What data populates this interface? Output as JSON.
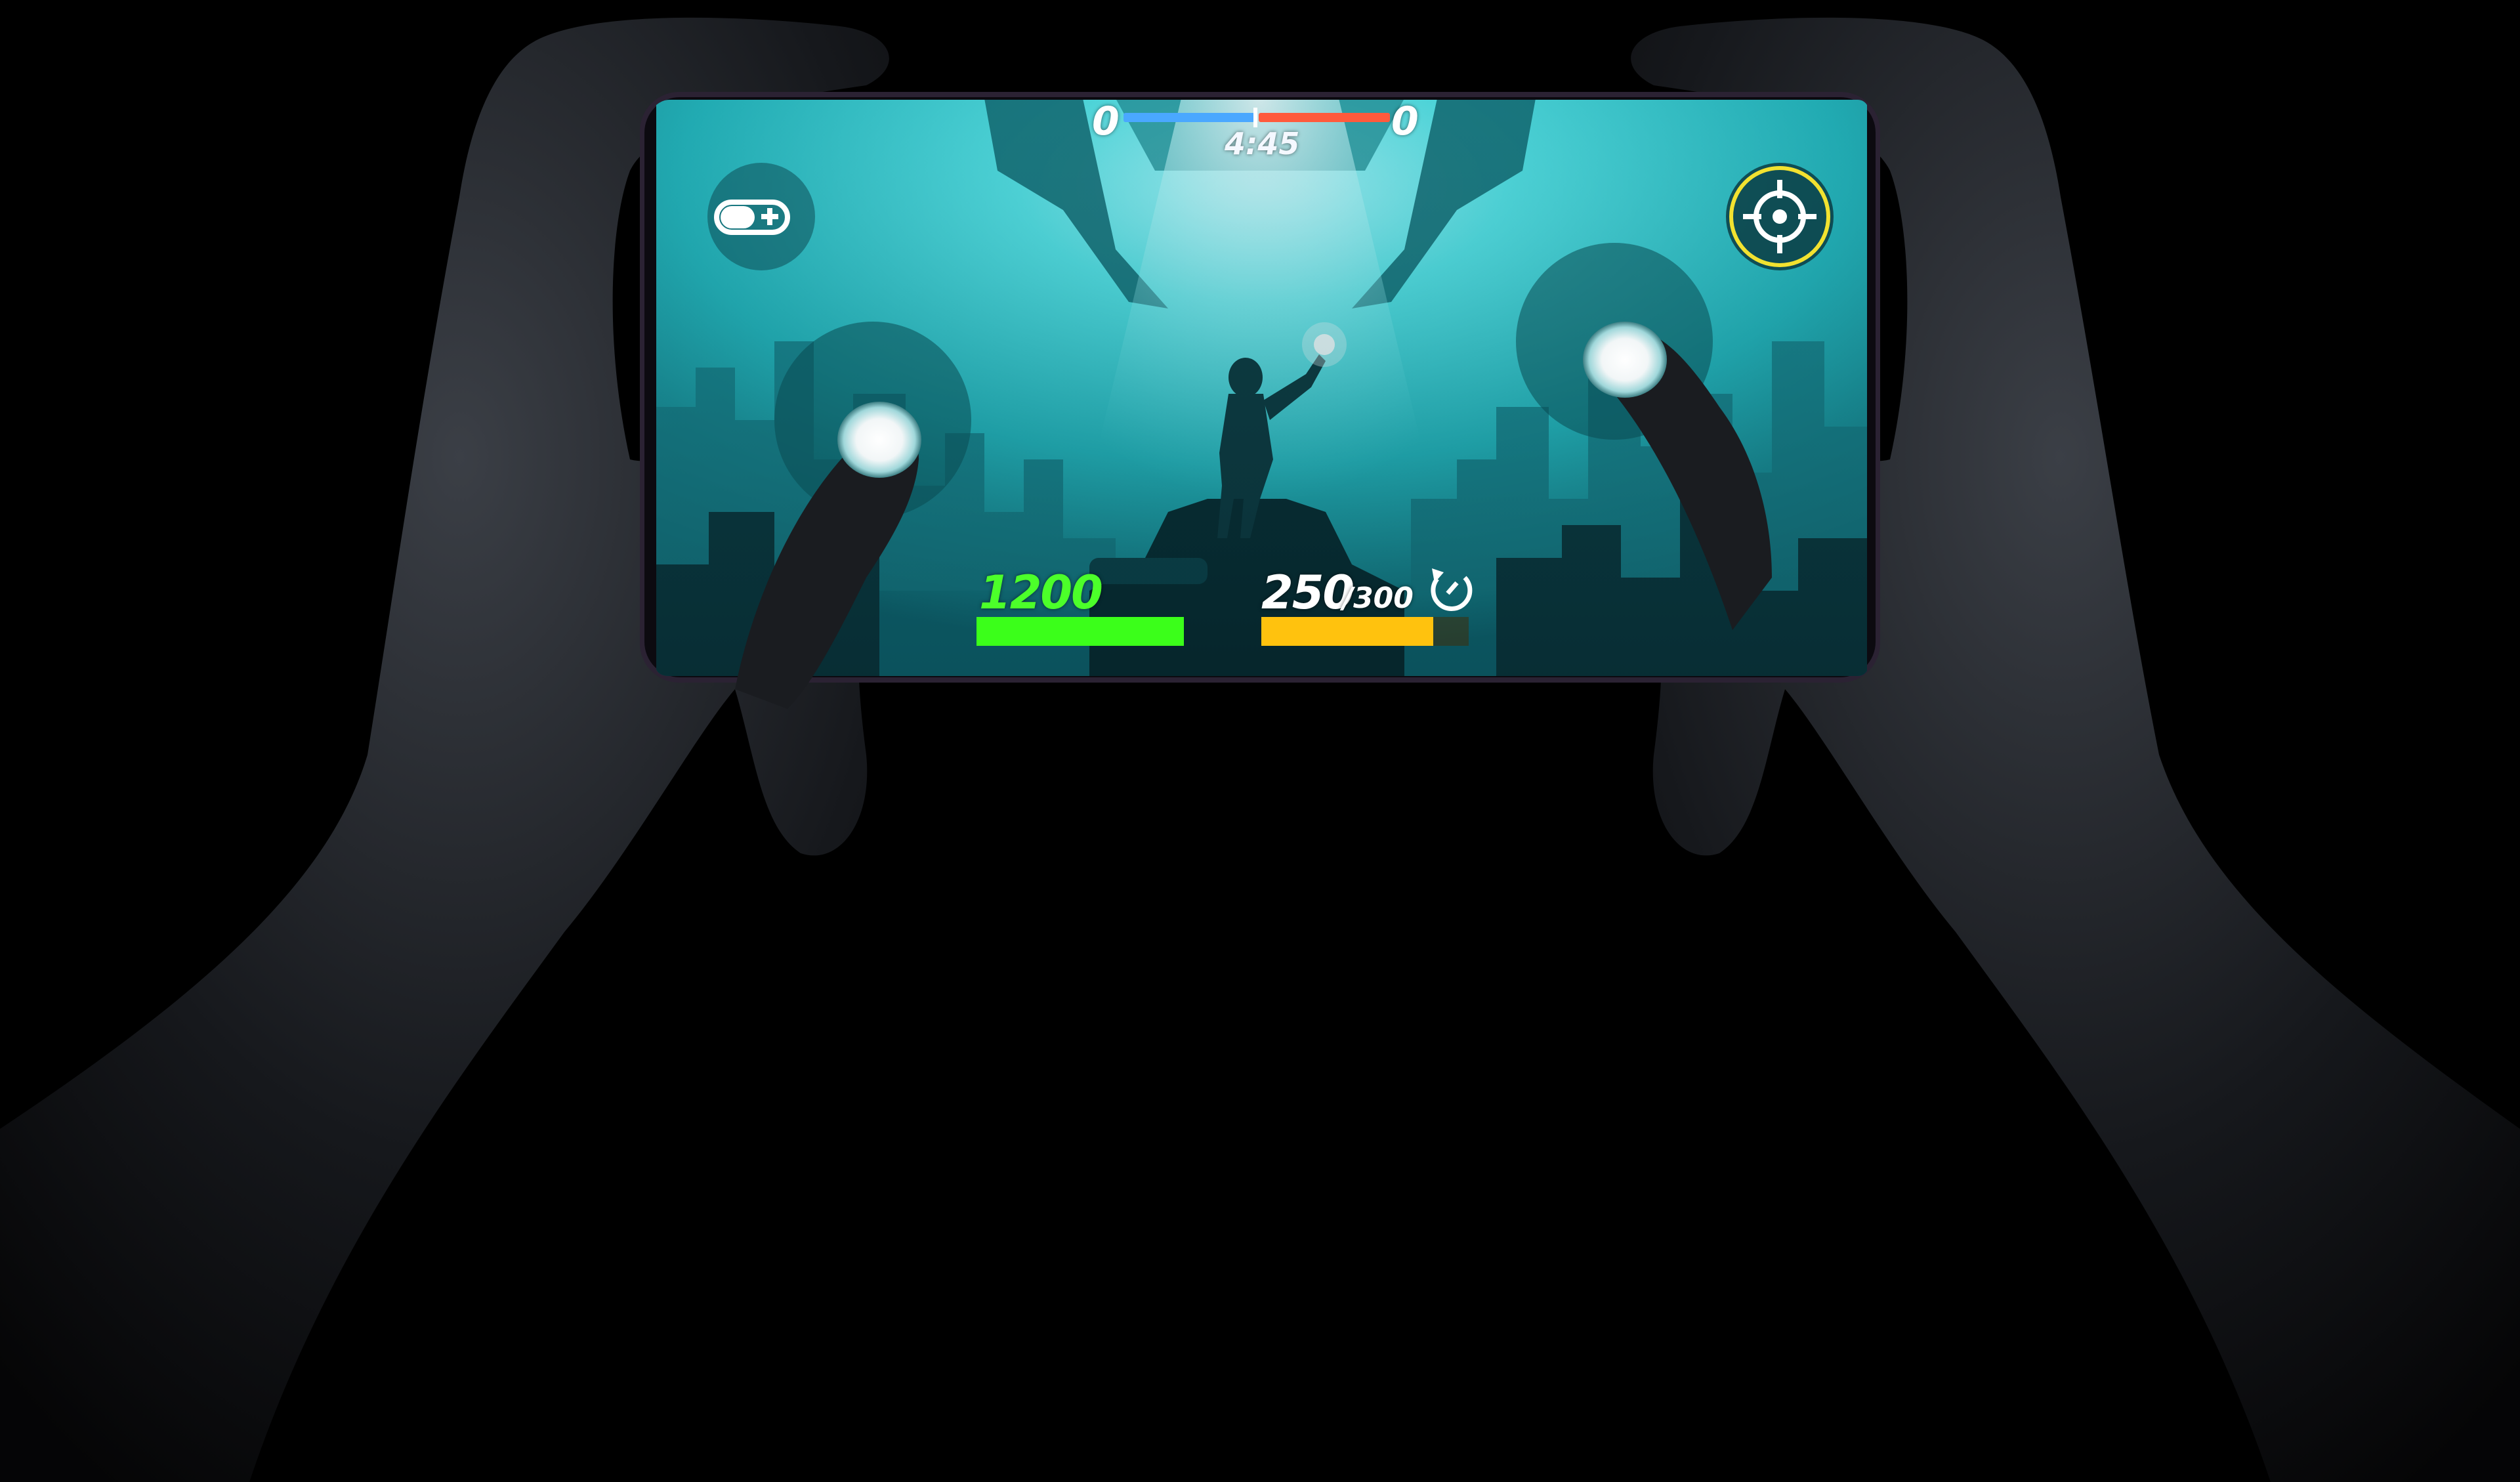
{
  "hud": {
    "team_left_score": "0",
    "team_right_score": "0",
    "match_timer": "4:45",
    "health": {
      "value": "1200",
      "fill_fraction": 1.0,
      "color": "#3bff1a"
    },
    "ammo": {
      "current": "250",
      "max": "/300",
      "fill_fraction": 0.83,
      "color": "#ffc20e"
    },
    "score_bar": {
      "left_color": "#4aa8ff",
      "right_color": "#ff5a3c"
    }
  },
  "icons": {
    "top_left_button": "battery-plus-icon",
    "top_right_button": "crosshair-icon",
    "reload_button": "reload-icon"
  },
  "controls": {
    "left_stick": "left-joystick",
    "right_stick": "right-joystick"
  },
  "colors": {
    "background": "#000000",
    "screen_teal": "#2fd6d6",
    "crosshair_ring": "#f2e230"
  }
}
